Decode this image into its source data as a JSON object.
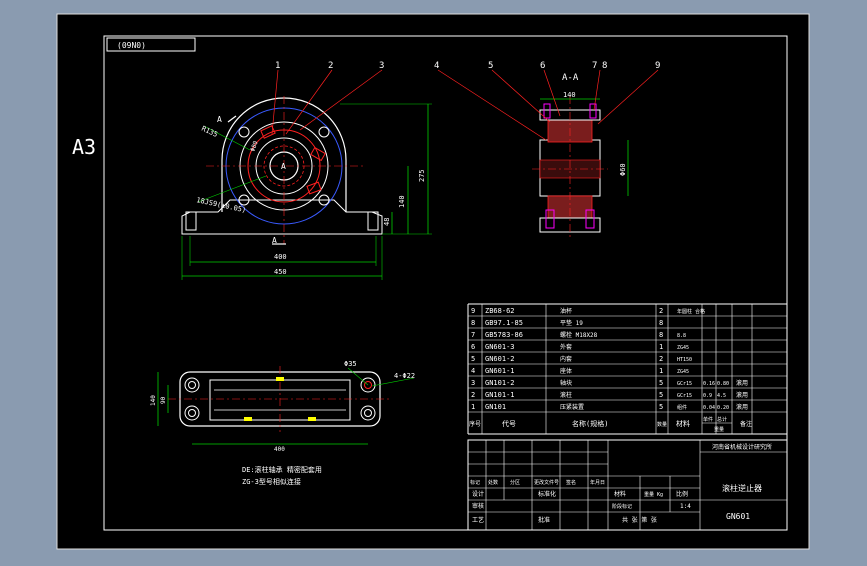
{
  "sheet": {
    "size_label": "A3",
    "drawing_number_box": "(09N0)",
    "section_label": "A-A",
    "section_marker": "A",
    "center_marker": "A"
  },
  "callouts": [
    "1",
    "2",
    "3",
    "4",
    "5",
    "6",
    "7",
    "8",
    "9"
  ],
  "dimensions": {
    "radius": "R135",
    "fit": "18JS9(±0.05)",
    "bore": "Φ80",
    "base_width_inner": "400",
    "base_width_outer": "450",
    "height_total": "275",
    "height_center": "140",
    "base_thickness": "48",
    "section_width": "140",
    "section_diameter": "Φ60",
    "top_hole": "Φ35",
    "bolt_holes": "4-Φ22",
    "plan_length": "400",
    "plan_width_outer": "140",
    "plan_width_inner": "90"
  },
  "notes": [
    "DE:滚柱轴承 精密配套用",
    "ZG-3型号相似连接"
  ],
  "bom_rows": [
    {
      "no": "9",
      "code": "ZB68-62",
      "name": "油杯",
      "qty": "2",
      "material": "年圆柱 合格",
      "w1": "",
      "w2": "",
      "remark": ""
    },
    {
      "no": "8",
      "code": "GB97.1-85",
      "name": "平垫 19",
      "qty": "8",
      "material": "",
      "w1": "",
      "w2": "",
      "remark": ""
    },
    {
      "no": "7",
      "code": "GB5783-86",
      "name": "螺栓 M18X28",
      "qty": "8",
      "material": "8.8",
      "w1": "",
      "w2": "",
      "remark": ""
    },
    {
      "no": "6",
      "code": "GN601-3",
      "name": "外套",
      "qty": "1",
      "material": "ZG45",
      "w1": "",
      "w2": "",
      "remark": ""
    },
    {
      "no": "5",
      "code": "GN601-2",
      "name": "内套",
      "qty": "2",
      "material": "HT150",
      "w1": "",
      "w2": "",
      "remark": ""
    },
    {
      "no": "4",
      "code": "GN601-1",
      "name": "座体",
      "qty": "1",
      "material": "ZG45",
      "w1": "",
      "w2": "",
      "remark": ""
    },
    {
      "no": "3",
      "code": "GN101-2",
      "name": "轴块",
      "qty": "5",
      "material": "GCr15",
      "w1": "0.16",
      "w2": "0.80",
      "remark": "滚用"
    },
    {
      "no": "2",
      "code": "GN101-1",
      "name": "滚柱",
      "qty": "5",
      "material": "GCr15",
      "w1": "0.9",
      "w2": "4.5",
      "remark": "滚用"
    },
    {
      "no": "1",
      "code": "GN101",
      "name": "压紧装置",
      "qty": "5",
      "material": "组件",
      "w1": "0.04",
      "w2": "0.20",
      "remark": "滚用"
    }
  ],
  "bom_header": {
    "no": "序号",
    "code": "代号",
    "name": "名称(规格)",
    "qty": "数量",
    "material": "材料",
    "weight_single": "单件",
    "weight_total": "总计",
    "weight": "重量",
    "remark": "备注"
  },
  "title_block": {
    "company": "河南省机械设计研究所",
    "product_name": "滚柱逆止器",
    "drawing_no": "GN601",
    "scale_label": "比例",
    "scale_value": "1:4",
    "weight_label": "重量 Kg",
    "sheet_count": "共 张 第 张",
    "row_design": "设计",
    "row_check": "审核",
    "row_process": "工艺",
    "row_standard": "标准化",
    "row_approve": "批准",
    "row_mark": "标记",
    "row_count": "处数",
    "row_zone": "分区",
    "row_change_doc": "更改文件号",
    "row_signature": "签名",
    "row_date": "年月日",
    "stage_mark": "阶段标记",
    "material_label": "材料"
  },
  "colors": {
    "background": "#8a9bb0",
    "paper": "#000000",
    "line_white": "#ffffff",
    "line_red": "#ff2020",
    "line_blue": "#3a5bff",
    "line_green": "#00d000",
    "line_magenta": "#ff00ff",
    "line_yellow": "#ffff00"
  }
}
